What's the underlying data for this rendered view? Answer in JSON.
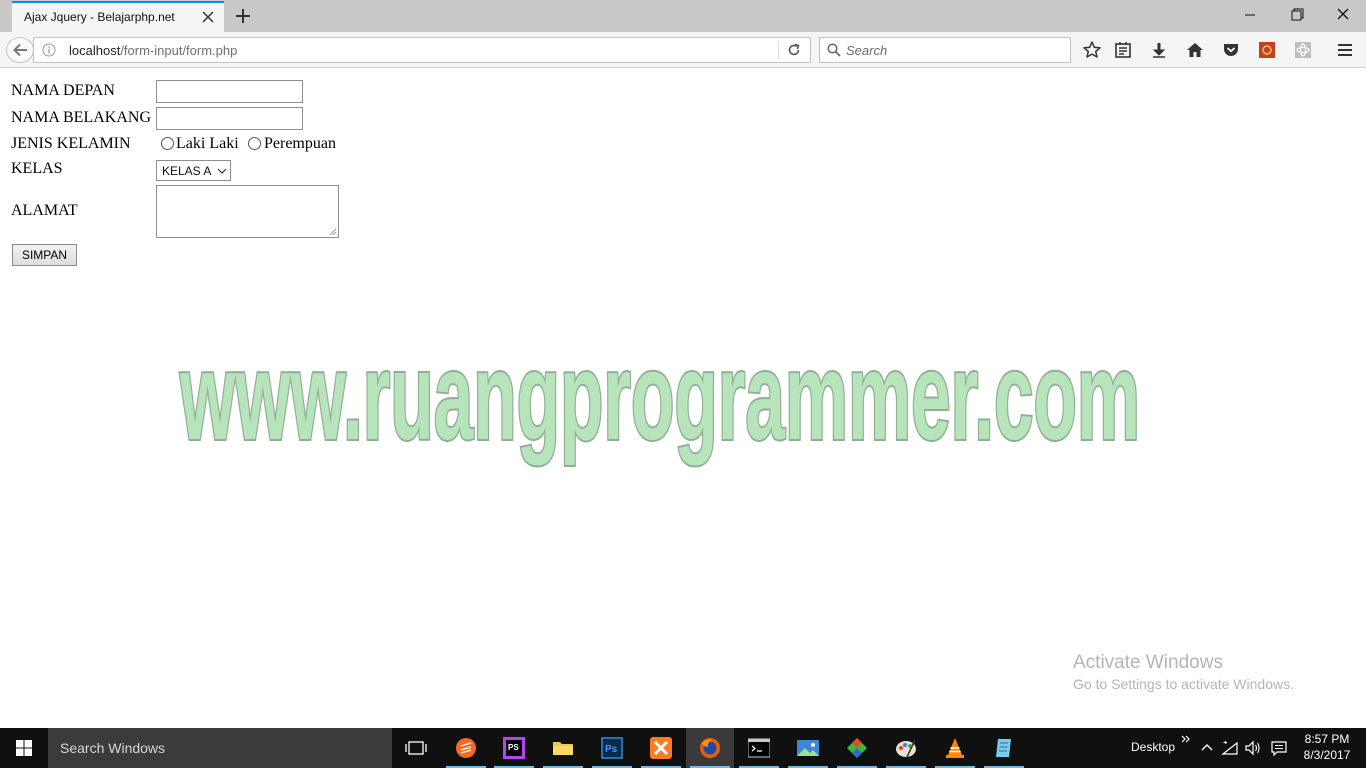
{
  "browser": {
    "tab_title": "Ajax Jquery - Belajarphp.net",
    "url_host": "localhost",
    "url_path": "/form-input/form.php",
    "search_placeholder": "Search"
  },
  "form": {
    "nama_depan_label": "NAMA DEPAN",
    "nama_depan_value": "",
    "nama_belakang_label": "NAMA BELAKANG",
    "nama_belakang_value": "",
    "jenis_kelamin_label": "JENIS KELAMIN",
    "gender_options": [
      "Laki Laki",
      "Perempuan"
    ],
    "gender_selected": null,
    "kelas_label": "KELAS",
    "kelas_selected": "KELAS A",
    "alamat_label": "ALAMAT",
    "alamat_value": "",
    "submit_label": "SIMPAN"
  },
  "watermark": "www.ruangprogrammer.com",
  "activation": {
    "title": "Activate Windows",
    "subtitle": "Go to Settings to activate Windows."
  },
  "taskbar": {
    "search_text": "Search Windows",
    "desktop_label": "Desktop",
    "time": "8:57 PM",
    "date": "8/3/2017",
    "apps": [
      "task-view",
      "sublime-text",
      "phpstorm",
      "file-explorer",
      "photoshop",
      "xampp",
      "firefox",
      "command-prompt",
      "photos",
      "git",
      "paint",
      "vlc",
      "notepad"
    ]
  }
}
